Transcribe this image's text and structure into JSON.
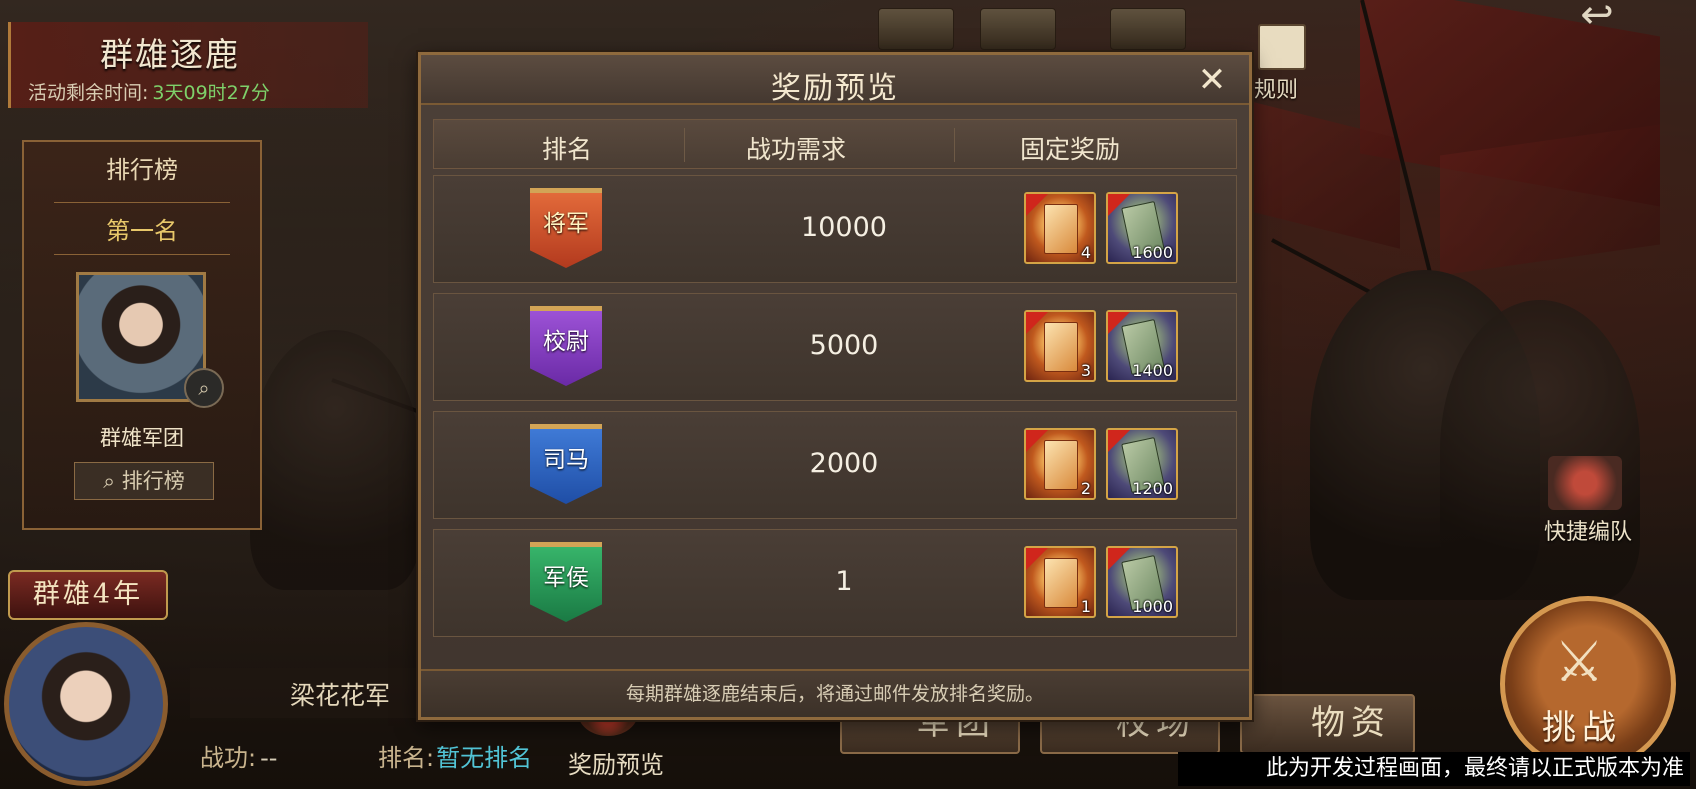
{
  "event": {
    "title": "群雄逐鹿",
    "remain_label": "活动剩余时间:",
    "remain_time": "3天09时27分"
  },
  "top_right": {
    "rules_label": "规则"
  },
  "ranking": {
    "header": "排行榜",
    "first_place": "第一名",
    "team_name": "群雄军团",
    "button_label": "排行榜",
    "search_icon": "search-icon"
  },
  "player": {
    "year_badge": "群雄4年",
    "name": "梁花花军",
    "merit_label": "战功:",
    "merit_value": "--",
    "rank_label": "排名:",
    "rank_value": "暂无排名",
    "reward_preview_label": "奖励预览"
  },
  "bottom_tabs": {
    "legion": "军团",
    "drill": "校场",
    "supplies": "物资"
  },
  "right": {
    "formation_label": "快捷编队",
    "challenge_label": "挑战",
    "challenge_icon": "crossed-swords-icon"
  },
  "dev_note": "此为开发过程画面，最终请以正式版本为准",
  "modal": {
    "title": "奖励预览",
    "close_icon": "close-icon",
    "columns": [
      "排名",
      "战功需求",
      "固定奖励"
    ],
    "rows": [
      {
        "rank": "将军",
        "color": "#d8502a",
        "requirement": "10000",
        "rewards": [
          {
            "icon": "red-book-icon",
            "count": "4"
          },
          {
            "icon": "scroll-icon",
            "count": "1600"
          }
        ]
      },
      {
        "rank": "校尉",
        "color": "#8a44c8",
        "requirement": "5000",
        "rewards": [
          {
            "icon": "red-book-icon",
            "count": "3"
          },
          {
            "icon": "scroll-icon",
            "count": "1400"
          }
        ]
      },
      {
        "rank": "司马",
        "color": "#2f64c0",
        "requirement": "2000",
        "rewards": [
          {
            "icon": "red-book-icon",
            "count": "2"
          },
          {
            "icon": "scroll-icon",
            "count": "1200"
          }
        ]
      },
      {
        "rank": "军侯",
        "color": "#27985a",
        "requirement": "1",
        "rewards": [
          {
            "icon": "red-book-icon",
            "count": "1"
          },
          {
            "icon": "scroll-icon",
            "count": "1000"
          }
        ]
      }
    ],
    "footer": "每期群雄逐鹿结束后，将通过邮件发放排名奖励。"
  }
}
